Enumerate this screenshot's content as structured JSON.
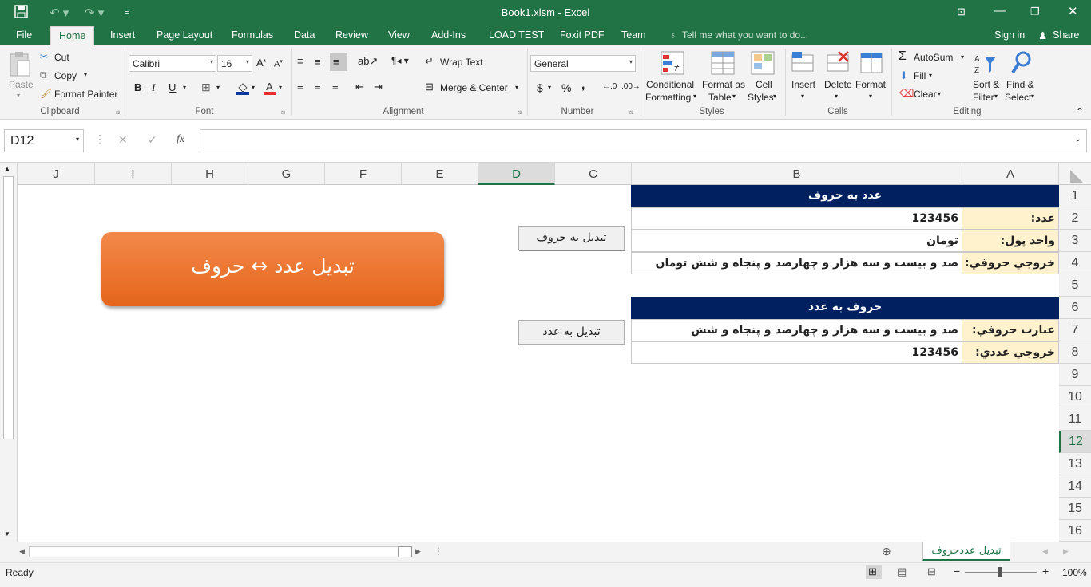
{
  "titlebar": {
    "title": "Book1.xlsm - Excel",
    "save_icon": "save-icon",
    "undo_icon": "undo-icon",
    "redo_icon": "redo-icon",
    "customize_icon": "customize-qat-icon"
  },
  "tabs": [
    "File",
    "Home",
    "Insert",
    "Page Layout",
    "Formulas",
    "Data",
    "Review",
    "View",
    "Add-Ins",
    "LOAD TEST",
    "Foxit PDF",
    "Team"
  ],
  "tell_me": "Tell me what you want to do...",
  "signin": "Sign in",
  "share": "Share",
  "ribbon": {
    "clipboard": {
      "paste": "Paste",
      "cut": "Cut",
      "copy": "Copy",
      "format_painter": "Format Painter",
      "label": "Clipboard"
    },
    "font": {
      "name": "Calibri",
      "size": "16",
      "bold": "B",
      "italic": "I",
      "underline": "U",
      "label": "Font"
    },
    "alignment": {
      "wrap": "Wrap Text",
      "merge": "Merge & Center",
      "label": "Alignment"
    },
    "number": {
      "format": "General",
      "currency": "$",
      "percent": "%",
      "comma": ",",
      "label": "Number"
    },
    "styles": {
      "conditional": "Conditional",
      "conditional2": "Formatting",
      "format_table": "Format as",
      "format_table2": "Table",
      "cell_styles": "Cell",
      "cell_styles2": "Styles",
      "label": "Styles"
    },
    "cells": {
      "insert": "Insert",
      "delete": "Delete",
      "format": "Format",
      "label": "Cells"
    },
    "editing": {
      "autosum": "AutoSum",
      "fill": "Fill",
      "clear": "Clear",
      "sort": "Sort &",
      "sort2": "Filter",
      "find": "Find &",
      "find2": "Select",
      "label": "Editing"
    }
  },
  "formula_bar": {
    "namebox": "D12",
    "value": ""
  },
  "columns": [
    "J",
    "I",
    "H",
    "G",
    "F",
    "E",
    "D",
    "C",
    "B",
    "A"
  ],
  "rows": [
    "1",
    "2",
    "3",
    "4",
    "5",
    "6",
    "7",
    "8",
    "9",
    "10",
    "11",
    "12",
    "13",
    "14",
    "15",
    "16"
  ],
  "cells": {
    "B1": "عدد به حروف",
    "A2": "عدد:",
    "B2": "123456",
    "A3": "واحد پول:",
    "B3": "تومان",
    "A4": "خروجي حروفي:",
    "B4": "صد و بيست و سه هزار و چهارصد و پنجاه و شش تومان",
    "B6": "حروف به عدد",
    "A7": "عبارت حروفي:",
    "B7": "صد و بيست و سه هزار و چهارصد و پنجاه و شش",
    "A8": "خروجي عددي:",
    "B8": "123456"
  },
  "buttons": {
    "to_words": "تبديل به حروف",
    "to_number": "تبديل به عدد",
    "banner": "تبديل عدد ↔ حروف"
  },
  "sheet_tab": "تبديل عددحروف",
  "status": {
    "ready": "Ready",
    "zoom": "100%"
  },
  "colors": {
    "excel_green": "#217346",
    "header_navy": "#002060",
    "label_fill": "#fff2cc",
    "banner_orange": "#ed7d31"
  }
}
